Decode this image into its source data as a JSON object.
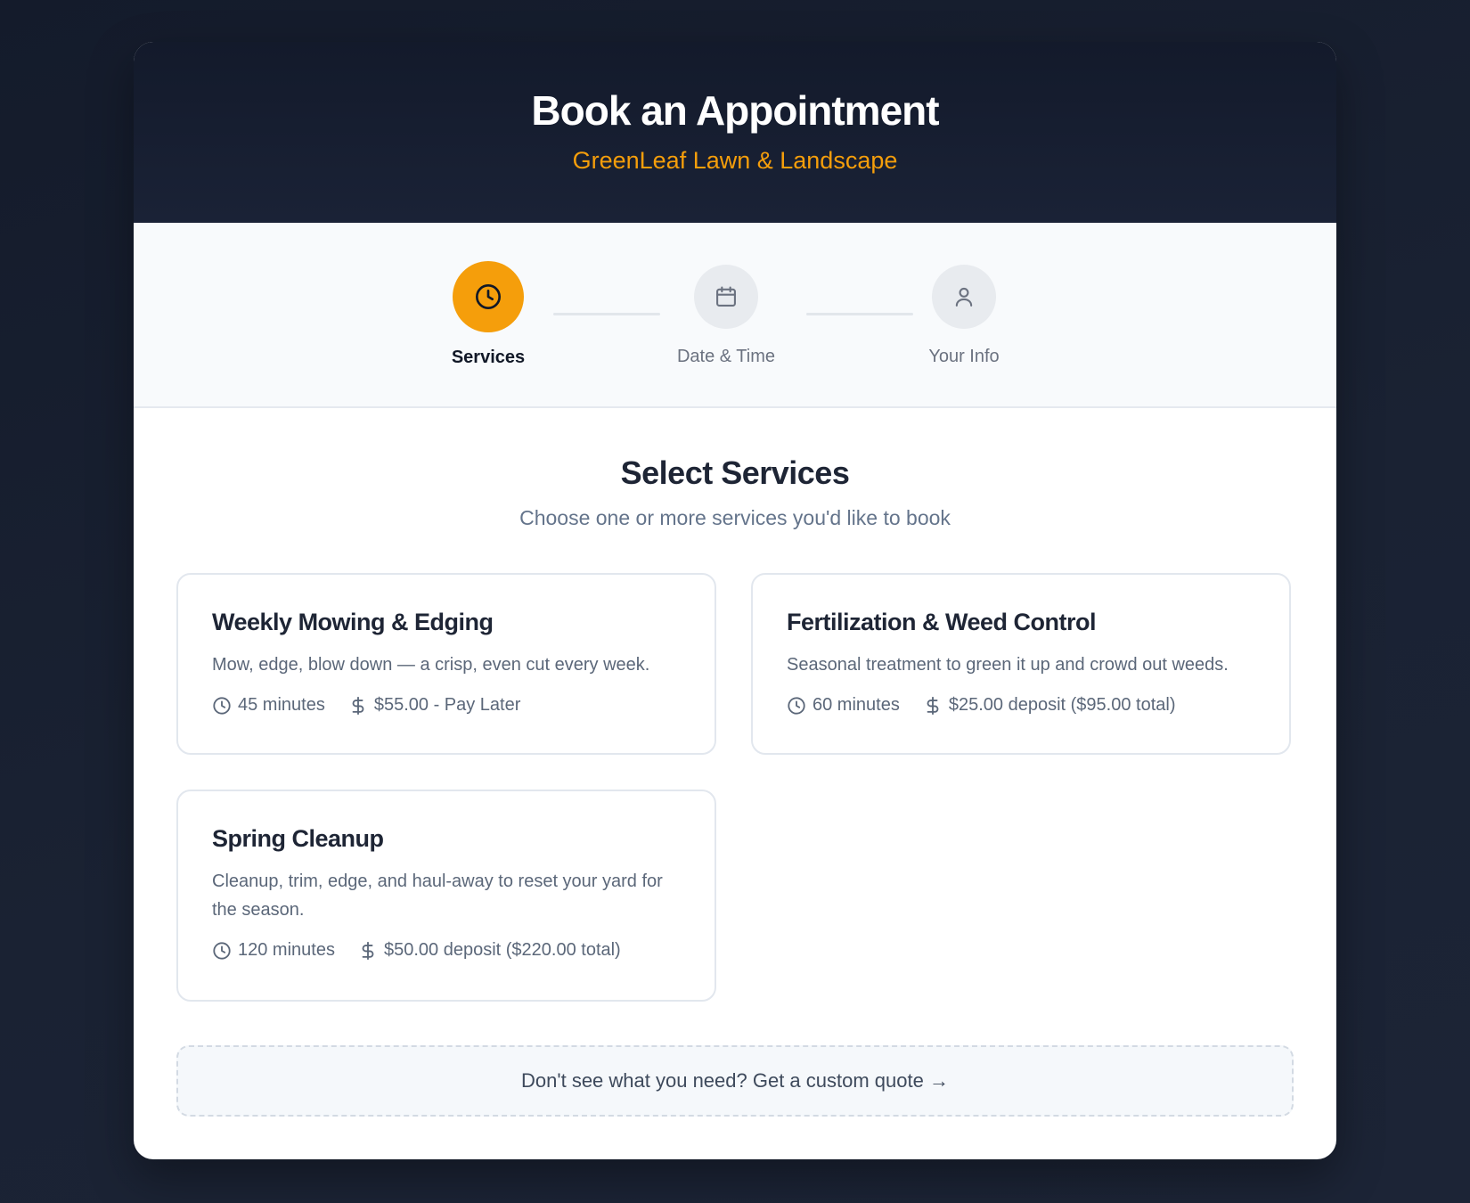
{
  "header": {
    "title": "Book an Appointment",
    "subtitle": "GreenLeaf Lawn & Landscape"
  },
  "steps": [
    {
      "label": "Services",
      "icon": "clock-icon",
      "active": true
    },
    {
      "label": "Date & Time",
      "icon": "calendar-icon",
      "active": false
    },
    {
      "label": "Your Info",
      "icon": "user-icon",
      "active": false
    }
  ],
  "main": {
    "title": "Select Services",
    "lead": "Choose one or more services you'd like to book"
  },
  "services": [
    {
      "name": "Weekly Mowing & Edging",
      "description": "Mow, edge, blow down — a crisp, even cut every week.",
      "duration": "45 minutes",
      "price": "$55.00 - Pay Later"
    },
    {
      "name": "Fertilization & Weed Control",
      "description": "Seasonal treatment to green it up and crowd out weeds.",
      "duration": "60 minutes",
      "price": "$25.00 deposit ($95.00 total)"
    },
    {
      "name": "Spring Cleanup",
      "description": "Cleanup, trim, edge, and haul-away to reset your yard for the season.",
      "duration": "120 minutes",
      "price": "$50.00 deposit ($220.00 total)"
    }
  ],
  "custom_quote": "Don't see what you need? Get a custom quote →",
  "colors": {
    "accent": "#f59e0b",
    "header_bg": "#131a2b",
    "page_bg": "#1a2233"
  }
}
